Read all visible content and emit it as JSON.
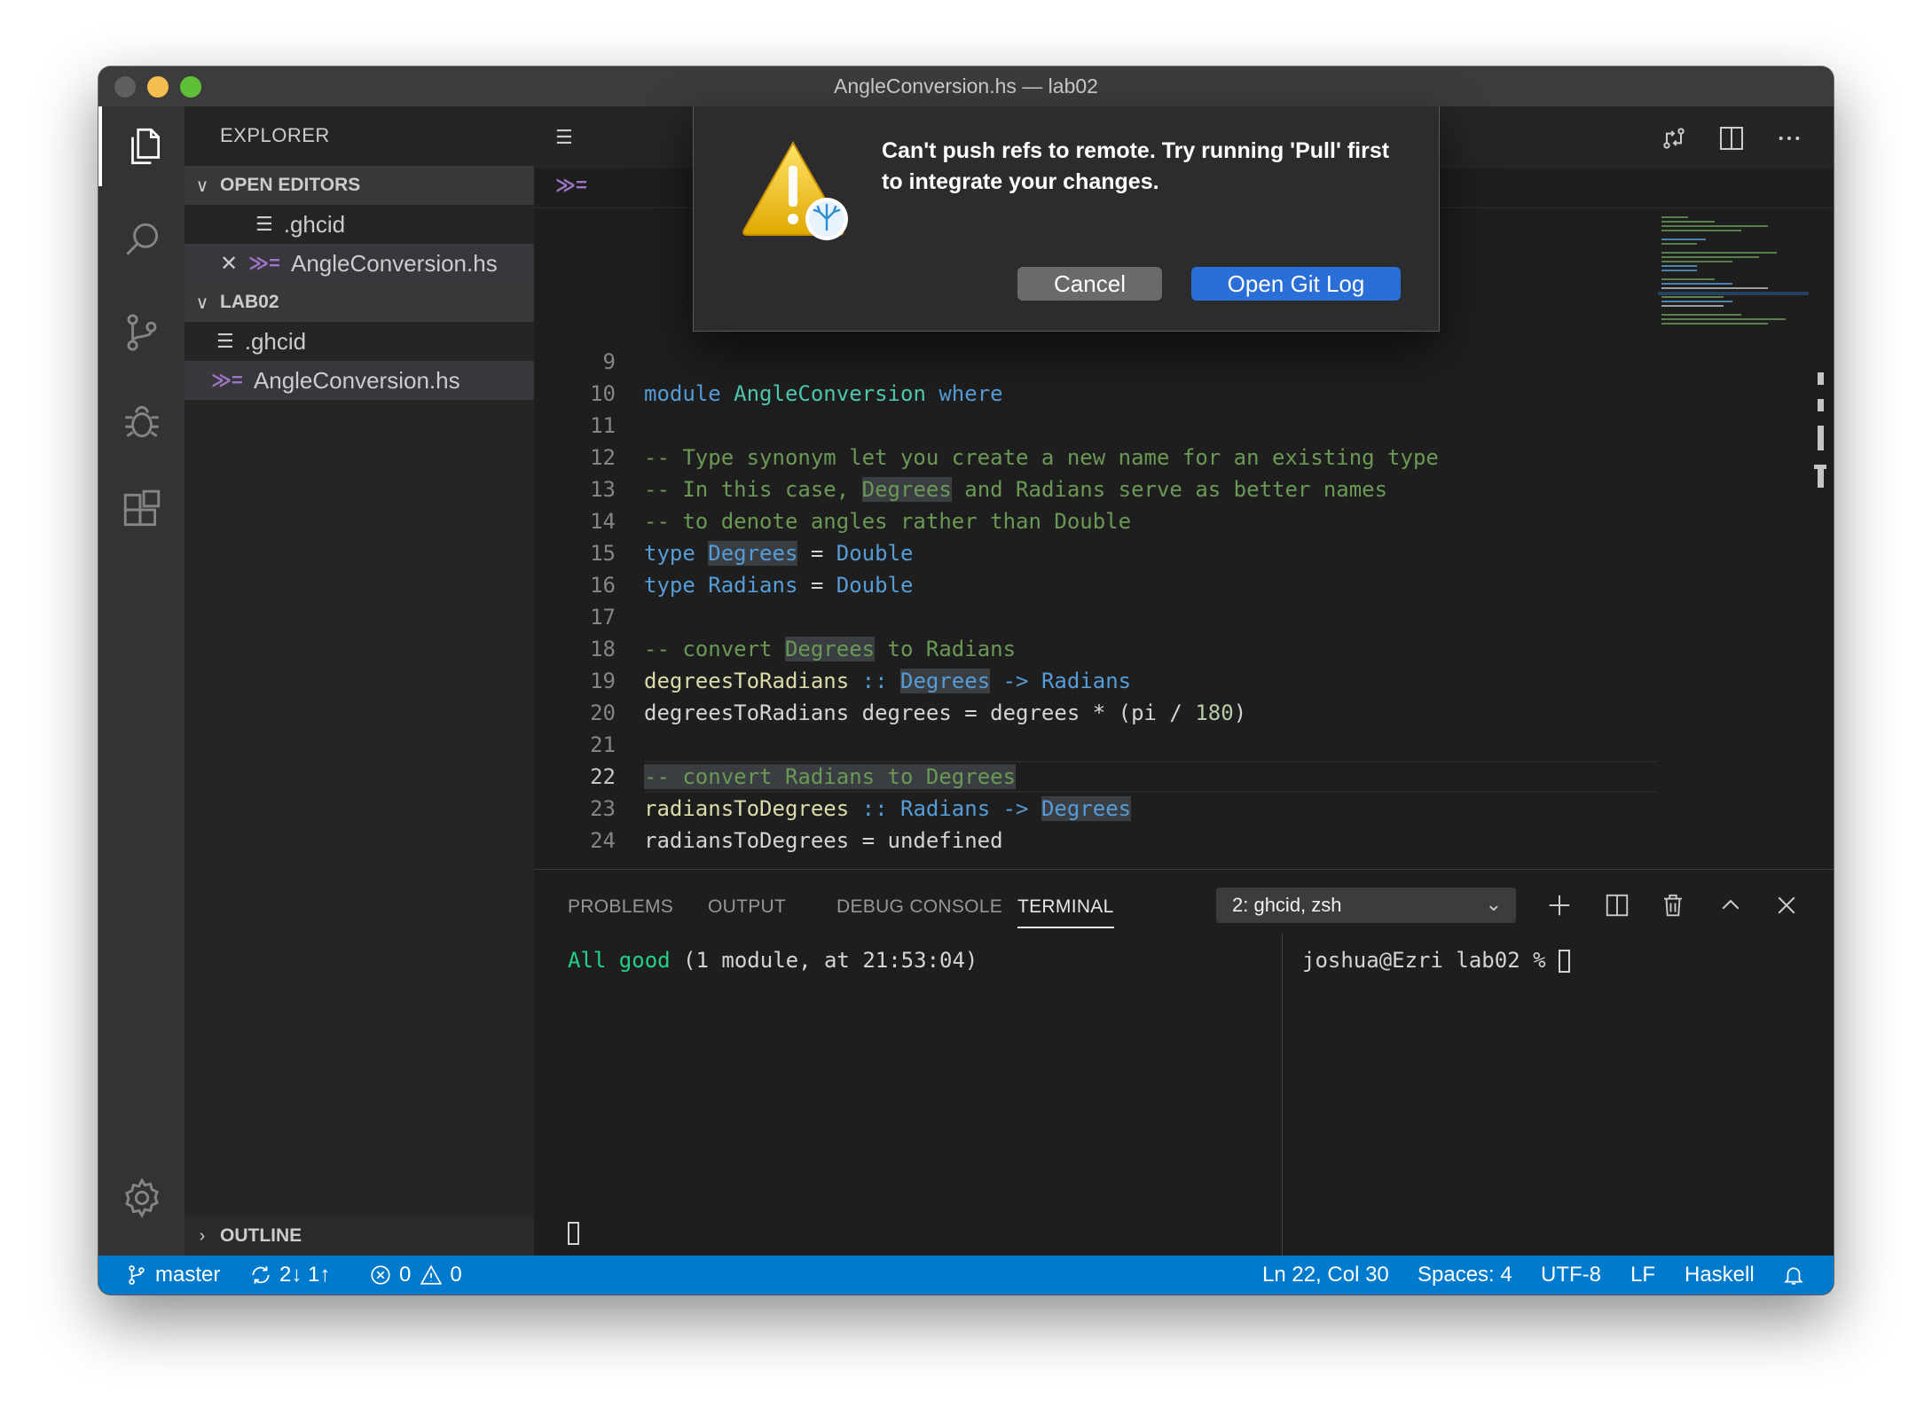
{
  "window": {
    "title": "AngleConversion.hs — lab02"
  },
  "sidebar": {
    "title": "EXPLORER",
    "open_editors": {
      "header": "OPEN EDITORS",
      "items": [
        ".ghcid",
        "AngleConversion.hs"
      ]
    },
    "folder": {
      "header": "LAB02",
      "items": [
        ".ghcid",
        "AngleConversion.hs"
      ]
    },
    "outline_header": "OUTLINE"
  },
  "dialog": {
    "message": "Can't push refs to remote. Try running 'Pull' first to integrate your changes.",
    "cancel_label": "Cancel",
    "primary_label": "Open Git Log"
  },
  "editor": {
    "lines": [
      {
        "n": "9"
      },
      {
        "n": "10"
      },
      {
        "n": "11"
      },
      {
        "n": "12"
      },
      {
        "n": "13"
      },
      {
        "n": "14"
      },
      {
        "n": "15"
      },
      {
        "n": "16"
      },
      {
        "n": "17"
      },
      {
        "n": "18"
      },
      {
        "n": "19"
      },
      {
        "n": "20"
      },
      {
        "n": "21"
      },
      {
        "n": "22"
      },
      {
        "n": "23"
      },
      {
        "n": "24"
      }
    ],
    "tokens": {
      "l10": [
        "module",
        "AngleConversion",
        "where"
      ],
      "l12": "-- Type synonym let you create a new name for an existing type",
      "l13a": "-- In this case, ",
      "l13b": "Degrees",
      "l13c": " and Radians serve as better names",
      "l14": "-- to denote angles rather than Double",
      "l15": [
        "type",
        "Degrees",
        "=",
        "Double"
      ],
      "l16": [
        "type",
        "Radians",
        "=",
        "Double"
      ],
      "l18a": "-- convert ",
      "l18b": "Degrees",
      "l18c": " to Radians",
      "l19": [
        "degreesToRadians",
        "::",
        "Degrees",
        "->",
        "Radians"
      ],
      "l20a": "degreesToRadians degrees = degrees * (pi / ",
      "l20b": "180",
      "l20c": ")",
      "l22a": "-- convert Radians to ",
      "l22b": "Degrees",
      "l23": [
        "radiansToDegrees",
        "::",
        "Radians",
        "->",
        "Degrees"
      ],
      "l24": "radiansToDegrees = undefined"
    }
  },
  "panel": {
    "tabs": [
      "PROBLEMS",
      "OUTPUT",
      "DEBUG CONSOLE",
      "TERMINAL"
    ],
    "active_tab": "TERMINAL",
    "terminal_select": "2: ghcid, zsh",
    "left_output_status": "All good",
    "left_output_rest": " (1 module, at 21:53:04)",
    "right_prompt": "joshua@Ezri lab02 % "
  },
  "statusbar": {
    "branch": "master",
    "sync": "2↓ 1↑",
    "errors": "0",
    "warnings": "0",
    "position": "Ln 22, Col 30",
    "spaces": "Spaces: 4",
    "encoding": "UTF-8",
    "eol": "LF",
    "language": "Haskell"
  },
  "colors": {
    "accent": "#007acc",
    "primary_button": "#2a6ed8",
    "terminal_green": "#23d18b"
  }
}
